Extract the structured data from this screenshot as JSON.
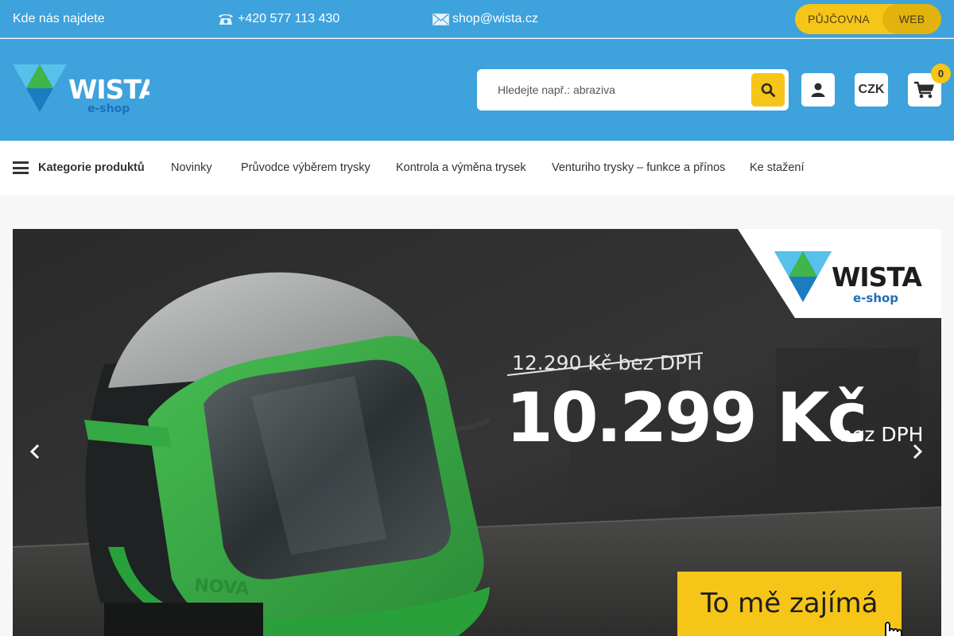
{
  "topbar": {
    "location_label": "Kde nás najdete",
    "phone": "+420 577 113 430",
    "email": "shop@wista.cz",
    "switch_a": "PŮJČOVNA",
    "switch_b": "WEB",
    "phone_icon": "phone-icon",
    "email_icon": "envelope-icon"
  },
  "header": {
    "logo_word": "WISTA",
    "logo_sub": "e-shop",
    "search_placeholder": "Hledejte např.: abraziva",
    "currency": "CZK",
    "cart_count": "0",
    "user_icon": "user-icon",
    "cart_icon": "cart-icon",
    "search_icon": "search-icon"
  },
  "nav": {
    "categories": "Kategorie produktů",
    "items": [
      "Novinky",
      "Průvodce výběrem trysky",
      "Kontrola a výměna trysek",
      "Venturiho trysky – funkce a přínos",
      "Ke stažení"
    ]
  },
  "banner": {
    "logo_word": "WISTA",
    "logo_sub": "e-shop",
    "old_price": "12.290 Kč bez DPH",
    "new_price": "10.299 Kč",
    "new_price_suffix": "bez DPH",
    "helmet_brand": "NOVA",
    "cta": "To mě zajímá"
  },
  "colors": {
    "primary_blue": "#3ea2dc",
    "accent_yellow": "#f5c518",
    "logo_green": "#3fb54a",
    "logo_blue": "#1c7cc1",
    "logo_lightblue": "#57c1ea",
    "helmet_green": "#3fae49"
  }
}
